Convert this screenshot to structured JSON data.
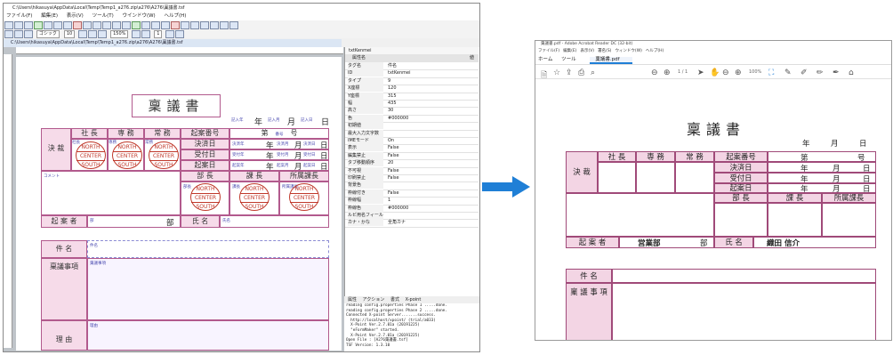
{
  "editor": {
    "title": "C:\\Users\\hikasuya\\AppData\\Local\\Temp\\Temp1_a276.zip\\a276\\A276\\稟議書.tsf",
    "menu": [
      "ファイル(F)",
      "編集(E)",
      "表示(V)",
      "ツール(T)",
      "ウインドウ(W)",
      "ヘルプ(H)"
    ],
    "font_name": "ゴシック",
    "font_size": "10",
    "zoom": "150%",
    "page_num": "1",
    "doc_tab": "C:\\Users\\hikasuya\\AppData\\Local\\Temp\\Temp1_a276.zip\\a276\\A276\\稟議書.tsf",
    "form": {
      "title": "稟議書",
      "date_labels": [
        "年",
        "月",
        "日"
      ],
      "header_fields": [
        "記入年",
        "記入月",
        "記入日"
      ],
      "kessai": "決 裁",
      "roles": [
        "社 長",
        "専 務",
        "常 務"
      ],
      "role_fields": [
        "社長",
        "専務",
        "常務"
      ],
      "stamp_lines": [
        "NORTH",
        "CENTER",
        "SOUTH"
      ],
      "kian_bango": "起案番号",
      "dai": "第",
      "go": "号",
      "bango_field": "番号",
      "kessai_bi": "決済日",
      "uketsuke_bi": "受付日",
      "kian_bi": "起案日",
      "date_fields": [
        "決済年",
        "決済月",
        "決済日",
        "受付年",
        "受付月",
        "受付日",
        "起案年",
        "起案月",
        "起案日"
      ],
      "comment": "コメント",
      "bucho": "部 長",
      "kacho": "課 長",
      "shozoku_kacho": "所属課長",
      "sub_fields": [
        "部長",
        "課長",
        "所属課長"
      ],
      "kiansha": "起 案 者",
      "bu": "部",
      "bu_field": "部",
      "shimei": "氏 名",
      "shimei_field": "氏名",
      "kenmei": "件 名",
      "kenmei_field": "件名",
      "ringi_jiko": "稟議事項",
      "ringi_field": "稟議事項",
      "riyu": "理 由",
      "riyu_field": "理由"
    },
    "props": {
      "header": "txtKenmei",
      "col_name": "属性名",
      "col_value": "値",
      "rows": [
        [
          "タグ名",
          "件名"
        ],
        [
          "ID",
          "txtKenmei"
        ],
        [
          "タイプ",
          "9"
        ],
        [
          "X座標",
          "120"
        ],
        [
          "Y座標",
          "315"
        ],
        [
          "幅",
          "435"
        ],
        [
          "高さ",
          "30"
        ],
        [
          "色",
          "#000000"
        ],
        [
          "初期値",
          ""
        ],
        [
          "最大入力文字数",
          ""
        ],
        [
          "IMEモード",
          "On"
        ],
        [
          "表示",
          "False"
        ],
        [
          "編集禁止",
          "False"
        ],
        [
          "タブ移動順序",
          "20"
        ],
        [
          "不可視",
          "False"
        ],
        [
          "印刷禁止",
          "False"
        ],
        [
          "背景色",
          ""
        ],
        [
          "枠線付き",
          "False"
        ],
        [
          "枠線幅",
          "1"
        ],
        [
          "枠線色",
          "#000000"
        ],
        [
          "ルビ用名フィールド",
          ""
        ],
        [
          "カナ・かな",
          "全角カナ"
        ]
      ]
    },
    "log_tabs": [
      "属性",
      "アクション",
      "書式",
      "X-point"
    ],
    "log": [
      "reading config.properties Phase 1 .....done.",
      "reading config.properties Phase 2 .....done.",
      "Connected X-point Server.......success.",
      "  http://localhost/xpoint/ (trial/a033)",
      "  X-Point Ver.2.7.01a (20191225)",
      "  \"eFormMaker\" started.",
      "  X-Point Ver.2.7.01a (20191225)",
      "Open File : [A276稟議書.tsf]",
      "TSF Version: 1.3.10"
    ]
  },
  "viewer": {
    "title": "稟議書.pdf - Adobe Acrobat Reader DC (32-bit)",
    "menu": [
      "ファイル(F)",
      "編集(E)",
      "表示(V)",
      "署名(S)",
      "ウィンドウ(W)",
      "ヘルプ(H)"
    ],
    "tabs": [
      "ホーム",
      "ツール",
      "稟議書.pdf"
    ],
    "page_indicator": "1 / 1",
    "zoom": "100%",
    "form": {
      "title": "稟議書",
      "year": "年",
      "month": "月",
      "day": "日",
      "kessai": "決 裁",
      "roles": [
        "社 長",
        "専 務",
        "常 務"
      ],
      "kian_bango": "起案番号",
      "dai": "第",
      "go": "号",
      "kessai_bi": "決済日",
      "uketsuke_bi": "受付日",
      "kian_bi": "起案日",
      "bucho": "部 長",
      "kacho": "課 長",
      "shozoku_kacho": "所属課長",
      "kiansha": "起 案 者",
      "department": "営業部",
      "bu": "部",
      "shimei": "氏 名",
      "name": "織田 信介",
      "kenmei": "件 名",
      "ringi_jiko": "稟 議 事 項"
    }
  },
  "colors": {
    "form_border": "#b25a8d",
    "form_fill": "#f6dbe9",
    "stamp": "#c0392b",
    "arrow": "#1f7fd6"
  }
}
